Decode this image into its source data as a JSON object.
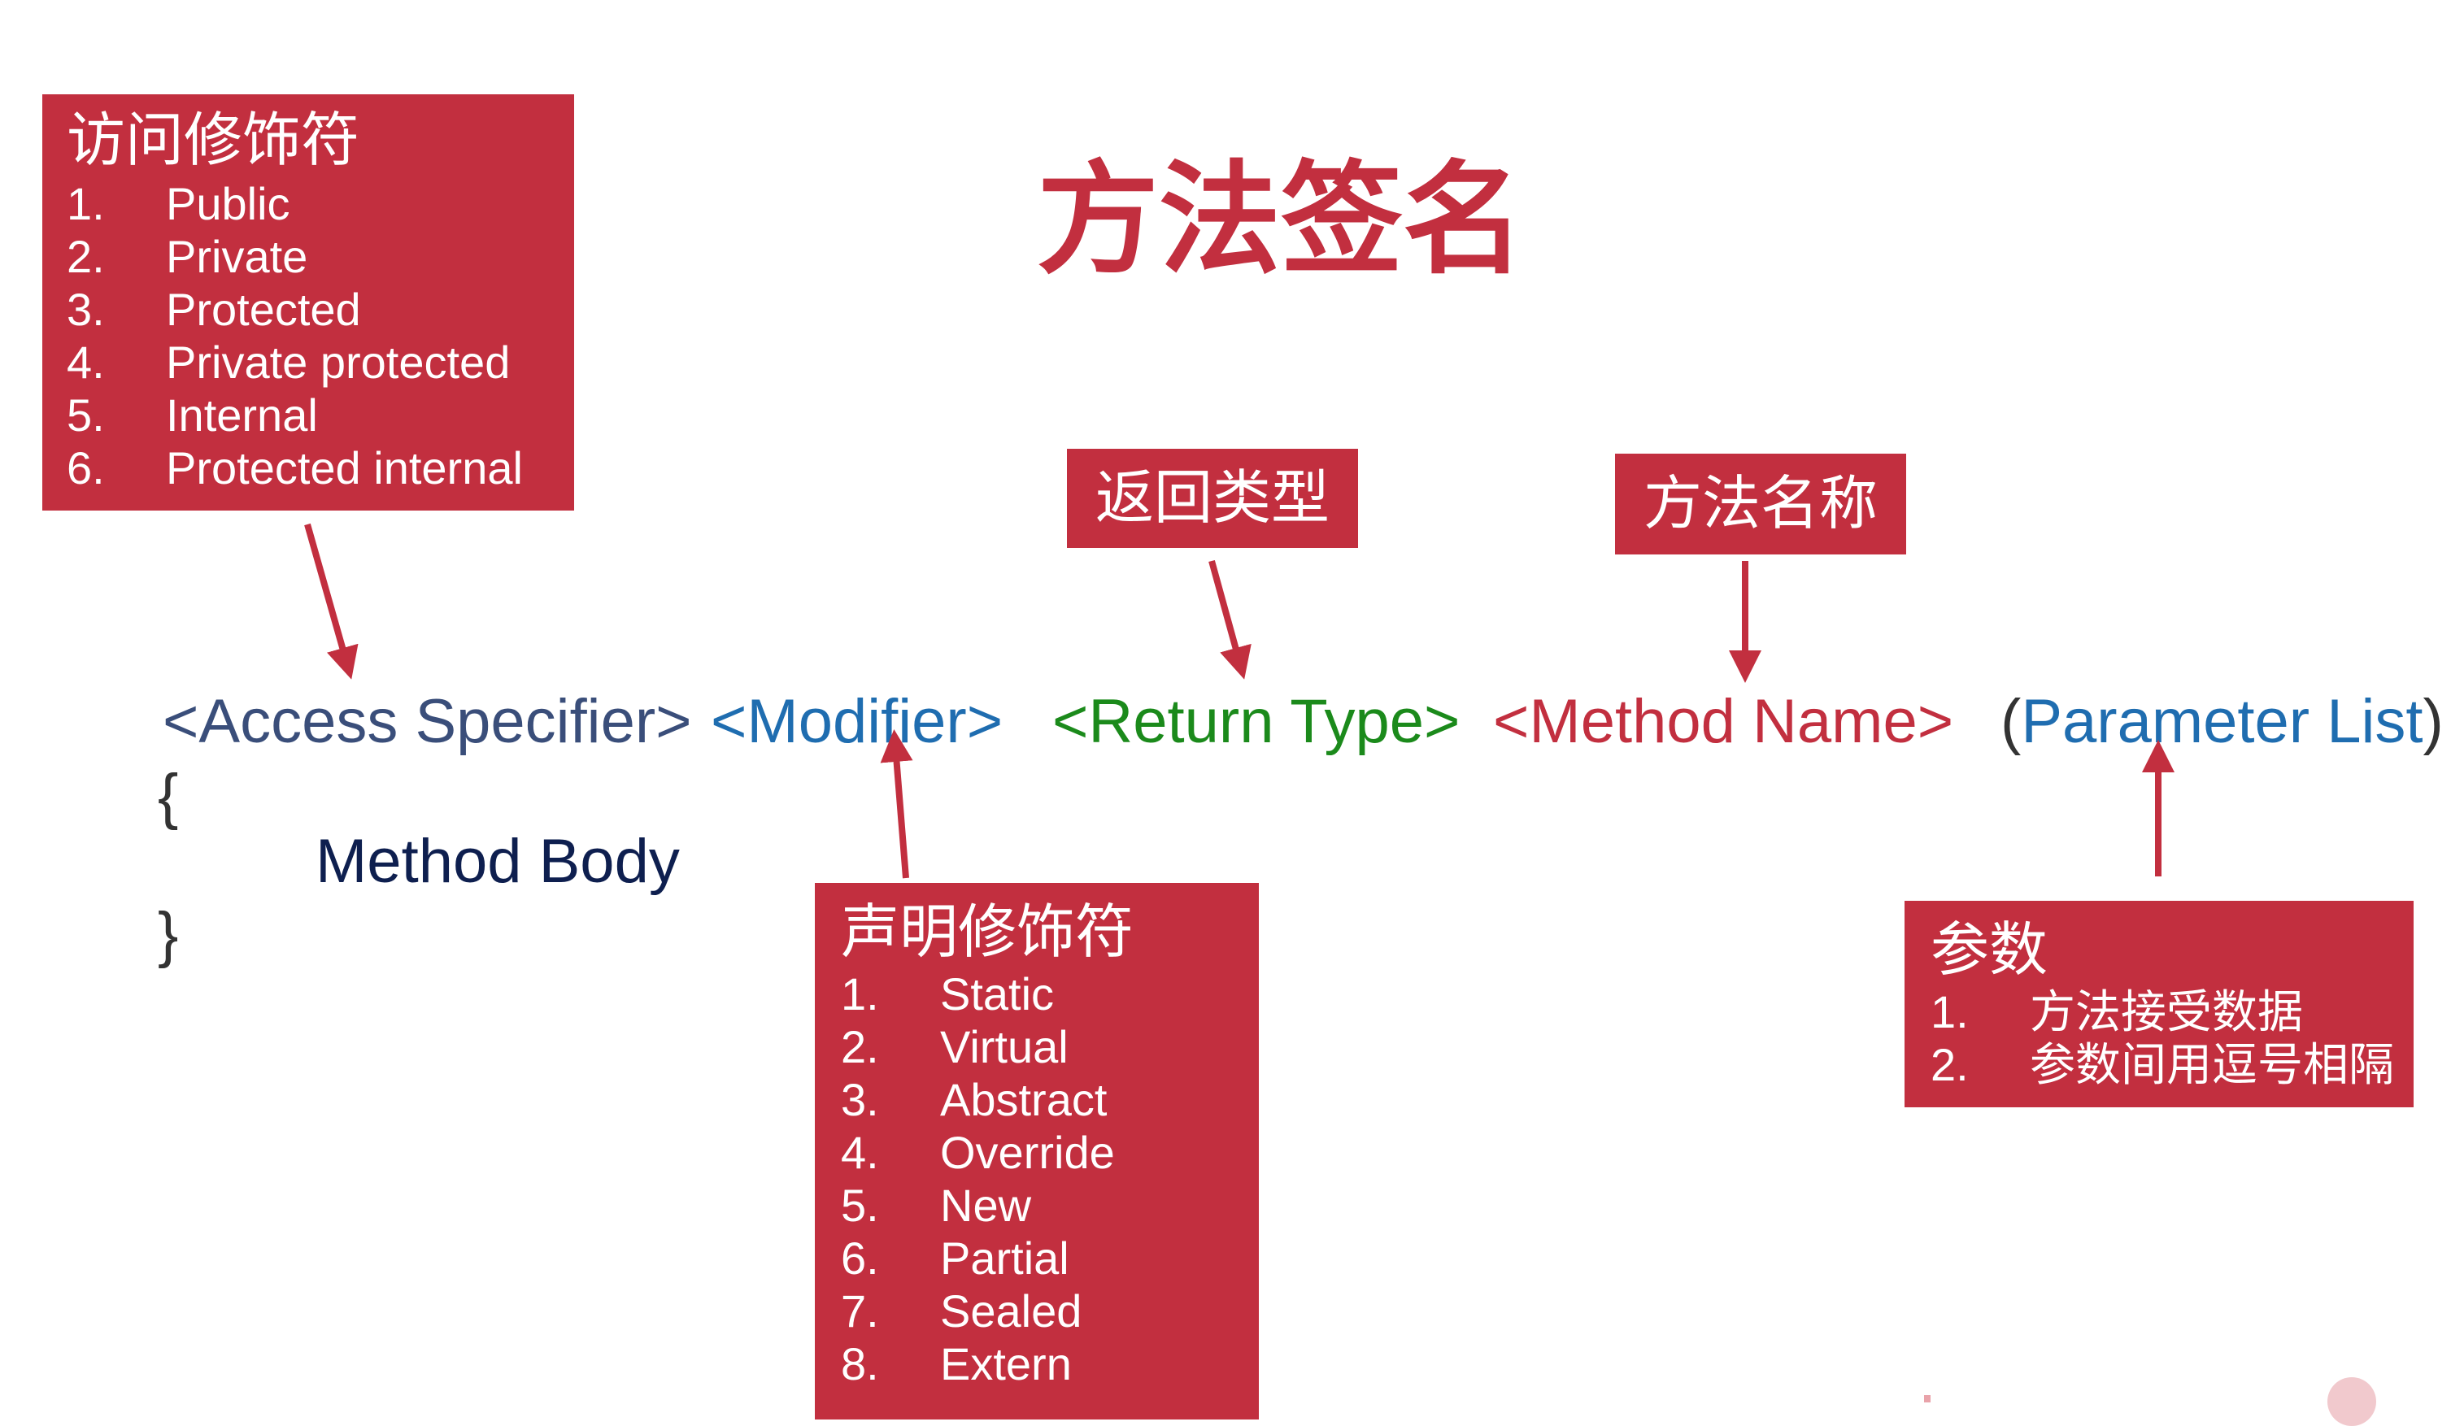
{
  "title": "方法签名",
  "access_box": {
    "heading": "访问修饰符",
    "items": [
      {
        "num": "1.",
        "text": "Public"
      },
      {
        "num": "2.",
        "text": "Private"
      },
      {
        "num": "3.",
        "text": "Protected"
      },
      {
        "num": "4.",
        "text": "Private protected"
      },
      {
        "num": "5.",
        "text": "Internal"
      },
      {
        "num": "6.",
        "text": "Protected internal"
      }
    ]
  },
  "return_type_label": "返回类型",
  "method_name_label": "方法名称",
  "signature": {
    "access": "<Access Specifier>",
    "modifier": "<Modifier>",
    "return_type": "<Return Type>",
    "method_name": "<Method Name>",
    "open_paren": "(",
    "parameter_list": "Parameter List",
    "close_paren": ")"
  },
  "body": {
    "open_brace": "{",
    "text": "Method Body",
    "close_brace": "}"
  },
  "modifier_box": {
    "heading": "声明修饰符",
    "items": [
      {
        "num": "1.",
        "text": "Static"
      },
      {
        "num": "2.",
        "text": "Virtual"
      },
      {
        "num": "3.",
        "text": "Abstract"
      },
      {
        "num": "4.",
        "text": "Override"
      },
      {
        "num": "5.",
        "text": "New"
      },
      {
        "num": "6.",
        "text": "Partial"
      },
      {
        "num": "7.",
        "text": "Sealed"
      },
      {
        "num": "8.",
        "text": "Extern"
      }
    ]
  },
  "params_box": {
    "heading": "参数",
    "items": [
      {
        "num": "1.",
        "text": "方法接受数据"
      },
      {
        "num": "2.",
        "text": "参数间用逗号相隔"
      }
    ]
  },
  "colors": {
    "accent_red": "#c22f3f",
    "access_text": "#3a4e7a",
    "modifier_text": "#1f6db0",
    "return_text": "#1b8a1b",
    "method_text": "#c22f3f",
    "body_text": "#0e1f4f"
  }
}
